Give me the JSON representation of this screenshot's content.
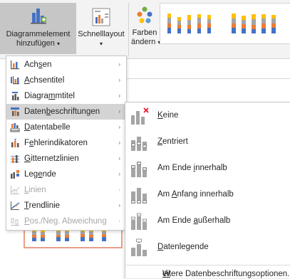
{
  "ribbon": {
    "add_element": {
      "line1": "Diagrammelement",
      "line2": "hinzufügen",
      "arrow": "▾",
      "icon": "add-chart-element-icon"
    },
    "quick_layout": {
      "line1": "Schnelllayout",
      "arrow": "▾",
      "icon": "quick-layout-icon"
    },
    "colors": {
      "line1": "Farben",
      "line2": "ändern",
      "arrow": "▾",
      "icon": "change-colors-icon"
    }
  },
  "menu": {
    "items": [
      {
        "pre": "Ach",
        "ul": "s",
        "post": "en",
        "icon": "axes-icon",
        "arrow": "›",
        "disabled": false,
        "highlighted": false
      },
      {
        "pre": "",
        "ul": "A",
        "post": "chsentitel",
        "icon": "axis-titles-icon",
        "arrow": "›",
        "disabled": false,
        "highlighted": false
      },
      {
        "pre": "Diagra",
        "ul": "m",
        "post": "mtitel",
        "icon": "chart-title-icon",
        "arrow": "›",
        "disabled": false,
        "highlighted": false
      },
      {
        "pre": "Daten",
        "ul": "b",
        "post": "eschriftungen",
        "icon": "data-labels-icon",
        "arrow": "›",
        "disabled": false,
        "highlighted": true
      },
      {
        "pre": "",
        "ul": "D",
        "post": "atentabelle",
        "icon": "data-table-icon",
        "arrow": "›",
        "disabled": false,
        "highlighted": false
      },
      {
        "pre": "F",
        "ul": "e",
        "post": "hlerindikatoren",
        "icon": "error-bars-icon",
        "arrow": "›",
        "disabled": false,
        "highlighted": false
      },
      {
        "pre": "",
        "ul": "G",
        "post": "itternetzlinien",
        "icon": "gridlines-icon",
        "arrow": "›",
        "disabled": false,
        "highlighted": false
      },
      {
        "pre": "Leg",
        "ul": "e",
        "post": "nde",
        "icon": "legend-icon",
        "arrow": "›",
        "disabled": false,
        "highlighted": false
      },
      {
        "pre": "",
        "ul": "L",
        "post": "inien",
        "icon": "lines-icon",
        "arrow": "›",
        "disabled": true,
        "highlighted": false
      },
      {
        "pre": "",
        "ul": "T",
        "post": "rendlinie",
        "icon": "trendline-icon",
        "arrow": "›",
        "disabled": false,
        "highlighted": false
      },
      {
        "pre": "",
        "ul": "P",
        "post": "os./Neg. Abweichung",
        "icon": "up-down-bars-icon",
        "arrow": "›",
        "disabled": true,
        "highlighted": false
      }
    ]
  },
  "submenu": {
    "items": [
      {
        "pre": "",
        "ul": "K",
        "post": "eine",
        "icon": "labels-none-icon"
      },
      {
        "pre": "",
        "ul": "Z",
        "post": "entriert",
        "icon": "labels-center-icon"
      },
      {
        "pre": "Am Ende ",
        "ul": "i",
        "post": "nnerhalb",
        "icon": "labels-inside-end-icon"
      },
      {
        "pre": "Am ",
        "ul": "A",
        "post": "nfang innerhalb",
        "icon": "labels-inside-base-icon"
      },
      {
        "pre": "Am Ende ",
        "ul": "a",
        "post": "ußerhalb",
        "icon": "labels-outside-end-icon"
      },
      {
        "pre": "",
        "ul": "D",
        "post": "atenlegende",
        "icon": "data-callout-icon"
      }
    ],
    "footer": {
      "pre": "",
      "ul": "W",
      "post": "eitere Datenbeschriftungsoptionen..."
    }
  },
  "colors": {
    "blue": "#4472c4",
    "orange": "#ed7d31",
    "gray": "#a5a5a5",
    "gold": "#ffc000",
    "highlight": "#d4d4d4",
    "active": "#c6c6c6",
    "border": "#c8c8c8",
    "chart_border": "#e8a088"
  }
}
